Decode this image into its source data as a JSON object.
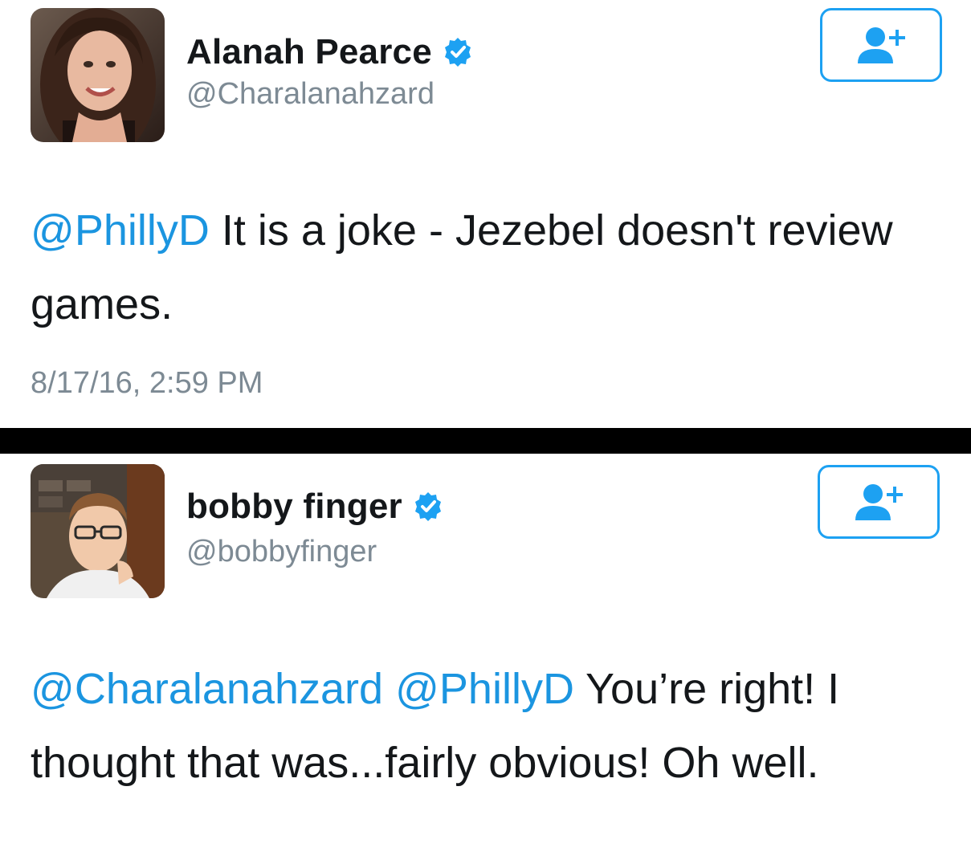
{
  "tweets": [
    {
      "display_name": "Alanah Pearce",
      "handle": "@Charalanahzard",
      "verified": true,
      "avatar_icon": "profile-photo",
      "follow_icon": "follow-user-plus-icon",
      "mentions": [
        "@PhillyD"
      ],
      "text": " It is a joke - Jezebel doesn't review games.",
      "timestamp": "8/17/16, 2:59 PM"
    },
    {
      "display_name": "bobby finger",
      "handle": "@bobbyfinger",
      "verified": true,
      "avatar_icon": "profile-photo",
      "follow_icon": "follow-user-plus-icon",
      "mentions": [
        "@Charalanahzard",
        "@PhillyD"
      ],
      "text": " You’re right! I thought that was...fairly obvious! Oh well."
    }
  ],
  "colors": {
    "accent": "#1b95e0",
    "text": "#14171a",
    "muted": "#7d8a94",
    "divider": "#000000"
  }
}
